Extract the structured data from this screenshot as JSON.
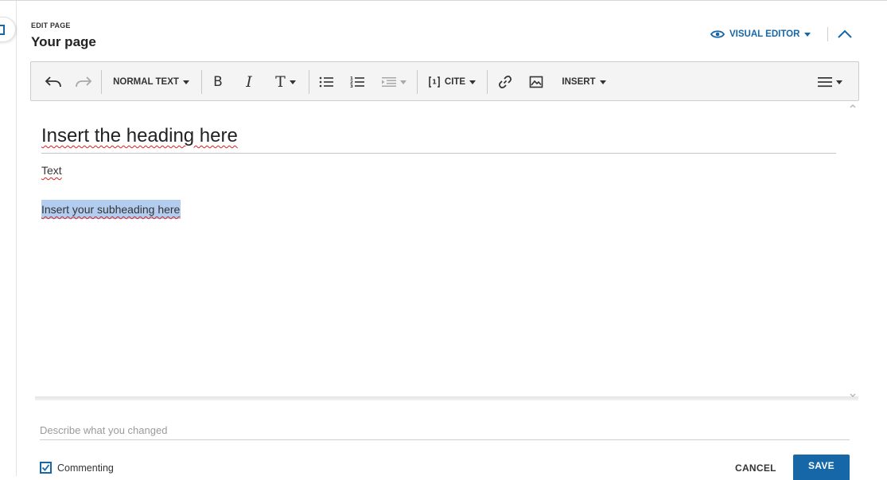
{
  "header": {
    "label": "EDIT PAGE",
    "title": "Your page",
    "visual_editor_label": "VISUAL EDITOR",
    "colors": {
      "accent": "#1667a8"
    }
  },
  "toolbar": {
    "undo_icon": "undo-icon",
    "redo_icon": "redo-icon",
    "paragraph_format_label": "NORMAL TEXT",
    "bold_glyph": "B",
    "italic_glyph": "I",
    "text_style_glyph": "T",
    "cite_label": "CITE",
    "insert_label": "INSERT"
  },
  "editor": {
    "heading": "Insert the heading here",
    "text": "Text",
    "subheading": "Insert your subheading here"
  },
  "footer": {
    "summary_placeholder": "Describe what you changed",
    "commenting_label": "Commenting",
    "commenting_checked": true,
    "cancel_label": "CANCEL",
    "save_label": "SAVE"
  }
}
